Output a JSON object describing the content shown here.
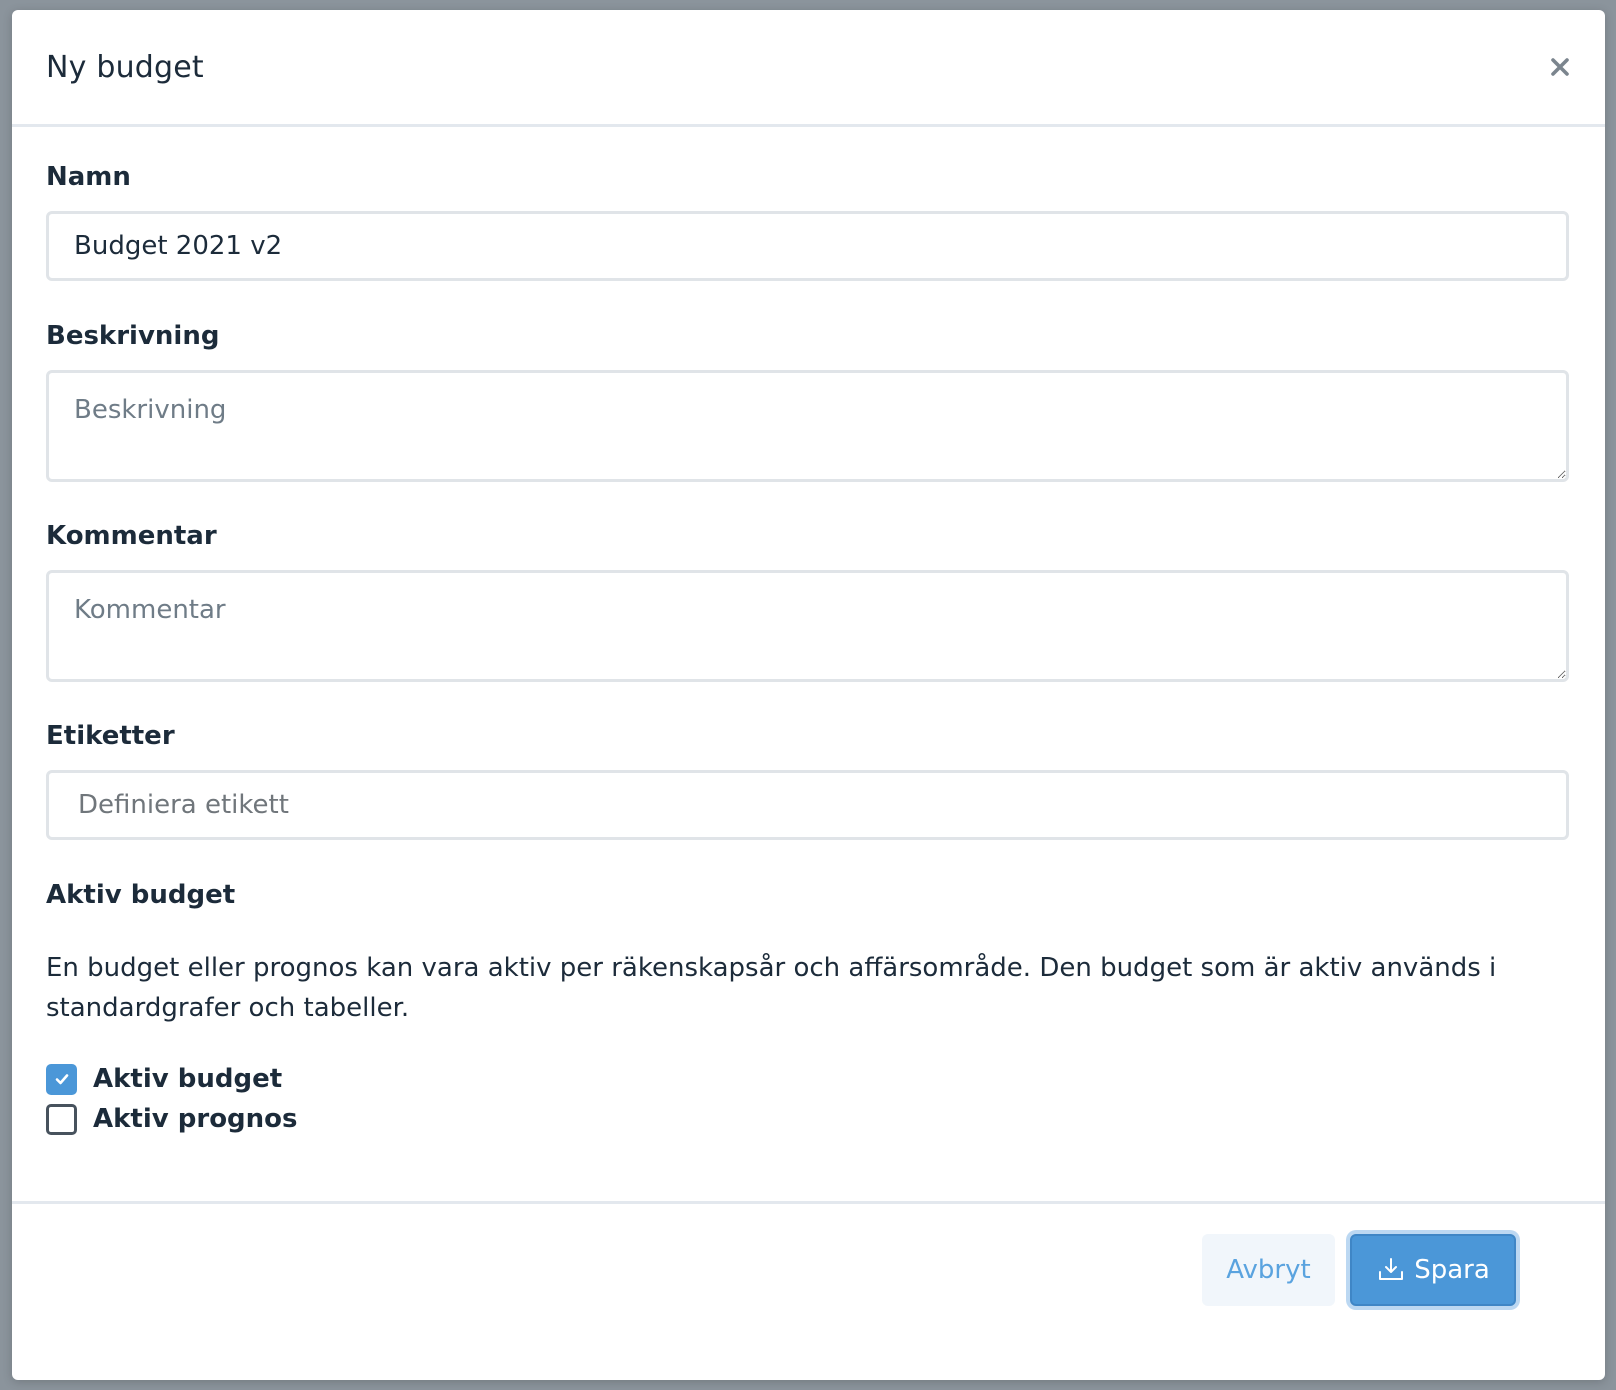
{
  "modal": {
    "title": "Ny budget",
    "close_icon": "close-icon"
  },
  "fields": {
    "name": {
      "label": "Namn",
      "value": "Budget 2021 v2"
    },
    "description": {
      "label": "Beskrivning",
      "placeholder": "Beskrivning",
      "value": ""
    },
    "comment": {
      "label": "Kommentar",
      "placeholder": "Kommentar",
      "value": ""
    },
    "tags": {
      "label": "Etiketter",
      "placeholder": "Definiera etikett",
      "value": ""
    }
  },
  "active": {
    "heading": "Aktiv budget",
    "help_text": "En budget eller prognos kan vara aktiv per räkenskapsår och affärsområde. Den budget som är aktiv används i standardgrafer och tabeller.",
    "options": [
      {
        "label": "Aktiv budget",
        "checked": true
      },
      {
        "label": "Aktiv prognos",
        "checked": false
      }
    ]
  },
  "footer": {
    "cancel_label": "Avbryt",
    "save_label": "Spara",
    "save_icon": "download-icon"
  },
  "colors": {
    "accent": "#4b97d8",
    "cancel_text": "#5aa3df",
    "text": "#1c2b3a",
    "backdrop": "#8b949c"
  }
}
